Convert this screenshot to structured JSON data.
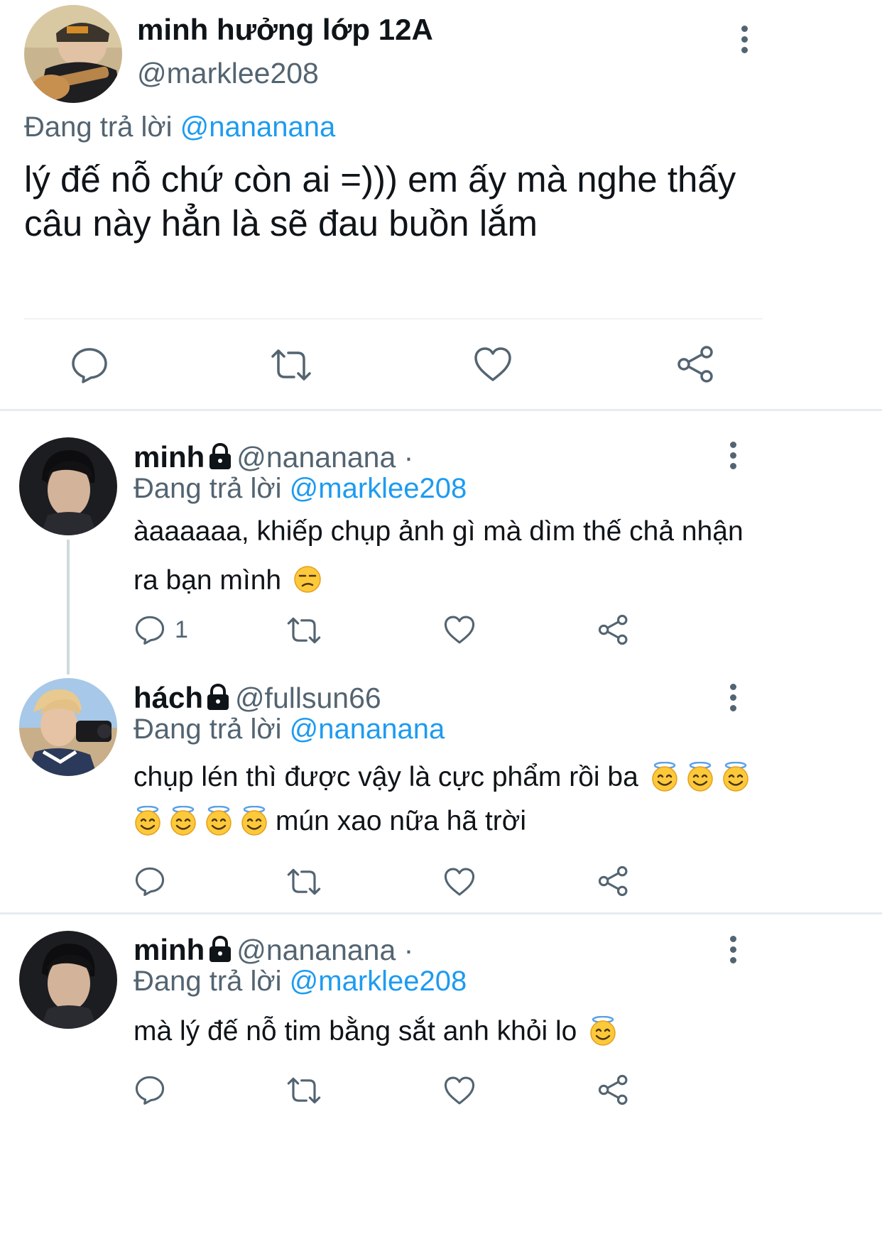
{
  "main_tweet": {
    "display_name": "minh hưởng lớp 12A",
    "handle": "@marklee208",
    "reply_prefix": "Đang trả lời",
    "reply_to": "@nananana",
    "text_line1": "lý đế nỗ chứ còn ai =))) em ấy mà nghe thấy",
    "text_line2": "câu này hẳn là sẽ đau buồn lắm"
  },
  "replies": [
    {
      "display_name": "minh",
      "handle": "@nananana ·",
      "reply_prefix": "Đang trả lời",
      "reply_to": "@marklee208",
      "text_line1": "àaaaaaa, khiếp chụp ảnh gì mà dìm thế chả nhận",
      "text_line2": "ra bạn mình",
      "emoji_end": "unamused-face-emoji",
      "reply_count": "1"
    },
    {
      "display_name": "hách",
      "handle": "@fullsun66",
      "reply_prefix": "Đang trả lời",
      "reply_to": "@nananana",
      "text_line1": "chụp lén thì được vậy là cực phẩm rồi ba",
      "text_line2": "mún xao nữa hã trời",
      "emoji": "smiling-face-with-halo-emoji"
    },
    {
      "display_name": "minh",
      "handle": "@nananana ·",
      "reply_prefix": "Đang trả lời",
      "reply_to": "@marklee208",
      "text_line1": "mà lý đế nỗ tim bằng sắt anh khỏi lo",
      "emoji": "smiling-face-with-halo-emoji"
    }
  ],
  "colors": {
    "link": "#1d9bf0",
    "muted": "#536471",
    "divider": "#eff3f4",
    "text": "#0f1419"
  }
}
